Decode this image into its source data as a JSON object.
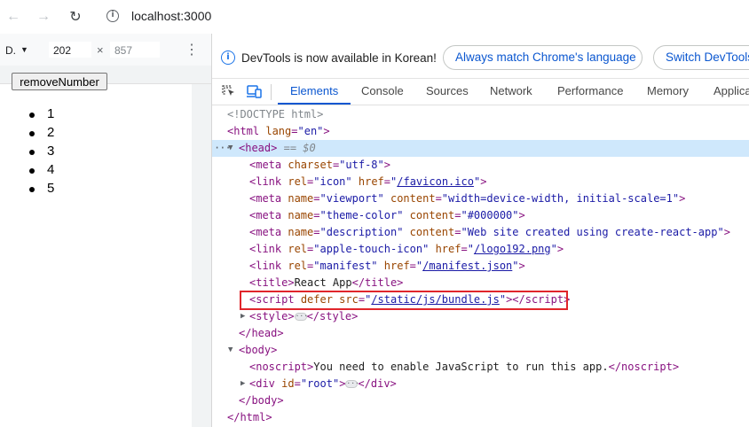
{
  "browser": {
    "url": "localhost:3000"
  },
  "device_toolbar": {
    "device": "D.",
    "width": "202",
    "height": "857",
    "times": "×"
  },
  "page": {
    "button_label": "removeNumber",
    "items": [
      "1",
      "2",
      "3",
      "4",
      "5"
    ]
  },
  "devtools": {
    "info_text": "DevTools is now available in Korean!",
    "match_button": "Always match Chrome's language",
    "switch_button": "Switch DevTools",
    "tabs": [
      "Elements",
      "Console",
      "Sources",
      "Network",
      "Performance",
      "Memory",
      "Applica"
    ],
    "active_tab": "Elements",
    "dom": {
      "doctype": "<!DOCTYPE html>",
      "html_open_tag": "<html",
      "html_lang_attr": "lang",
      "html_lang_val": "\"en\"",
      "head_tag": "<head>",
      "selected_marker": "== $0",
      "meta_charset_val": "\"utf-8\"",
      "favicon_href": "/favicon.ico",
      "viewport_val": "\"width=device-width, initial-scale=1\"",
      "theme_color_val": "\"#000000\"",
      "description_val": "\"Web site created using create-react-app\"",
      "apple_icon_href": "/logo192.png",
      "manifest_href": "/manifest.json",
      "title_text": "React App",
      "script_src": "/static/js/bundle.js",
      "noscript_text": "You need to enable JavaScript to run this app.",
      "root_id": "\"root\""
    }
  }
}
